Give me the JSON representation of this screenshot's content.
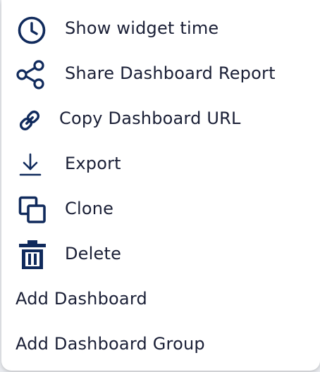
{
  "menu": {
    "items": [
      {
        "label": "Show widget time",
        "icon": "clock-icon"
      },
      {
        "label": "Share Dashboard Report",
        "icon": "share-icon"
      },
      {
        "label": "Copy Dashboard URL",
        "icon": "link-icon"
      },
      {
        "label": "Export",
        "icon": "download-icon"
      },
      {
        "label": "Clone",
        "icon": "clone-icon"
      },
      {
        "label": "Delete",
        "icon": "trash-icon"
      },
      {
        "label": "Add Dashboard"
      },
      {
        "label": "Add Dashboard Group"
      }
    ]
  },
  "colors": {
    "icon": "#102a5c",
    "text": "#1a1f36",
    "background": "#ffffff"
  }
}
